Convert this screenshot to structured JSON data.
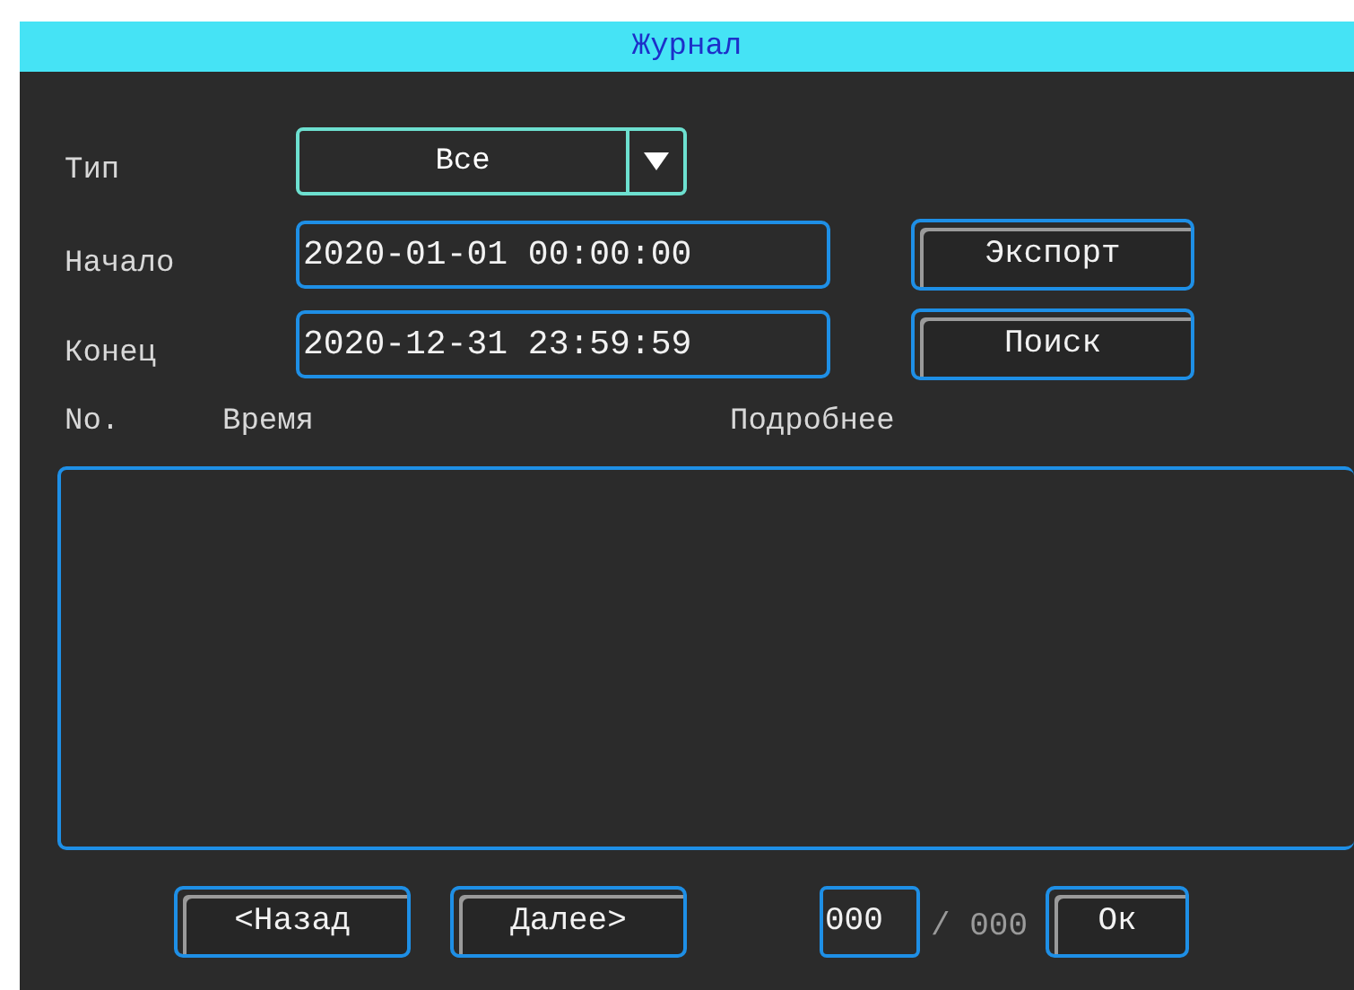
{
  "window": {
    "title": "Журнал"
  },
  "form": {
    "type_label": "Тип",
    "type_value": "Все",
    "start_label": "Начало",
    "start_value": "2020-01-01 00:00:00",
    "end_label": "Конец",
    "end_value": "2020-12-31 23:59:59",
    "buttons": [
      "Экспорт",
      "Поиск"
    ]
  },
  "table": {
    "columns": [
      "No.",
      "Время",
      "Подробнее"
    ]
  },
  "pager": {
    "prev": "<Назад",
    "next": "Далее>",
    "page": "000",
    "total": "/ 000",
    "ok": "Ок"
  }
}
